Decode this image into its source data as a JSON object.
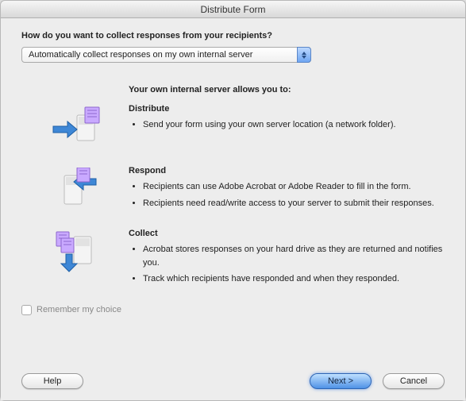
{
  "title": "Distribute Form",
  "question": "How do you want to collect responses from your recipients?",
  "select": {
    "value": "Automatically collect responses on my own internal server"
  },
  "intro": "Your own internal server allows you to:",
  "sections": {
    "distribute": {
      "title": "Distribute",
      "items": [
        "Send your form using your own server location (a network folder)."
      ]
    },
    "respond": {
      "title": "Respond",
      "items": [
        "Recipients can use Adobe Acrobat or Adobe Reader to fill in the form.",
        "Recipients need read/write access to your server to submit their responses."
      ]
    },
    "collect": {
      "title": "Collect",
      "items": [
        "Acrobat stores responses on your hard drive as they are returned and notifies you.",
        "Track which recipients have responded and when they responded."
      ]
    }
  },
  "remember_label": "Remember my choice",
  "buttons": {
    "help": "Help",
    "next": "Next >",
    "cancel": "Cancel"
  }
}
